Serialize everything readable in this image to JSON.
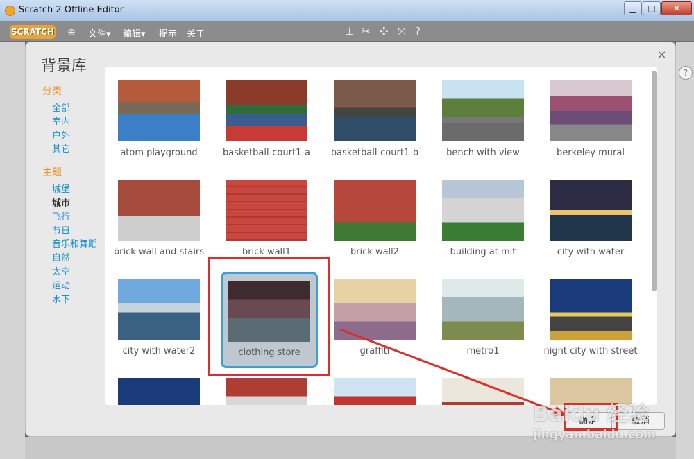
{
  "window": {
    "title": "Scratch 2 Offline Editor",
    "minimize": "▁",
    "maximize": "□",
    "close": "✕"
  },
  "menubar": {
    "logo": "SCRATCH",
    "items": [
      "文件▾",
      "编辑▾",
      "提示",
      "关于"
    ],
    "tool_icons": [
      "stamp-icon",
      "scissors-icon",
      "expand-icon",
      "shrink-icon",
      "help-icon"
    ]
  },
  "dialog": {
    "title": "背景库",
    "close": "×",
    "sidebar": {
      "category_heading": "分类",
      "categories": [
        "全部",
        "室内",
        "户外",
        "其它"
      ],
      "theme_heading": "主题",
      "themes": [
        "城堡",
        "城市",
        "飞行",
        "节日",
        "音乐和舞蹈",
        "自然",
        "太空",
        "运动",
        "水下"
      ],
      "active_theme": "城市"
    },
    "backdrops": [
      {
        "name": "atom playground"
      },
      {
        "name": "basketball-court1-a"
      },
      {
        "name": "basketball-court1-b"
      },
      {
        "name": "bench with view"
      },
      {
        "name": "berkeley mural"
      },
      {
        "name": "brick wall and stairs"
      },
      {
        "name": "brick wall1"
      },
      {
        "name": "brick wall2"
      },
      {
        "name": "building at mit"
      },
      {
        "name": "city with water"
      },
      {
        "name": "city with water2"
      },
      {
        "name": "clothing store"
      },
      {
        "name": "graffiti"
      },
      {
        "name": "metro1"
      },
      {
        "name": "night city with street"
      },
      {
        "name": ""
      },
      {
        "name": ""
      },
      {
        "name": ""
      },
      {
        "name": ""
      },
      {
        "name": ""
      }
    ],
    "selected": "clothing store",
    "ok_label": "确定",
    "cancel_label": "取消"
  },
  "colors": {
    "accent": "#3aa0d6",
    "heading": "#f0922a",
    "link": "#1a8fd1",
    "annotation": "#d9302c"
  },
  "watermark": {
    "logo": "Baidu 经验",
    "url": "jingyan.baidu.com"
  },
  "help_icon": "?"
}
